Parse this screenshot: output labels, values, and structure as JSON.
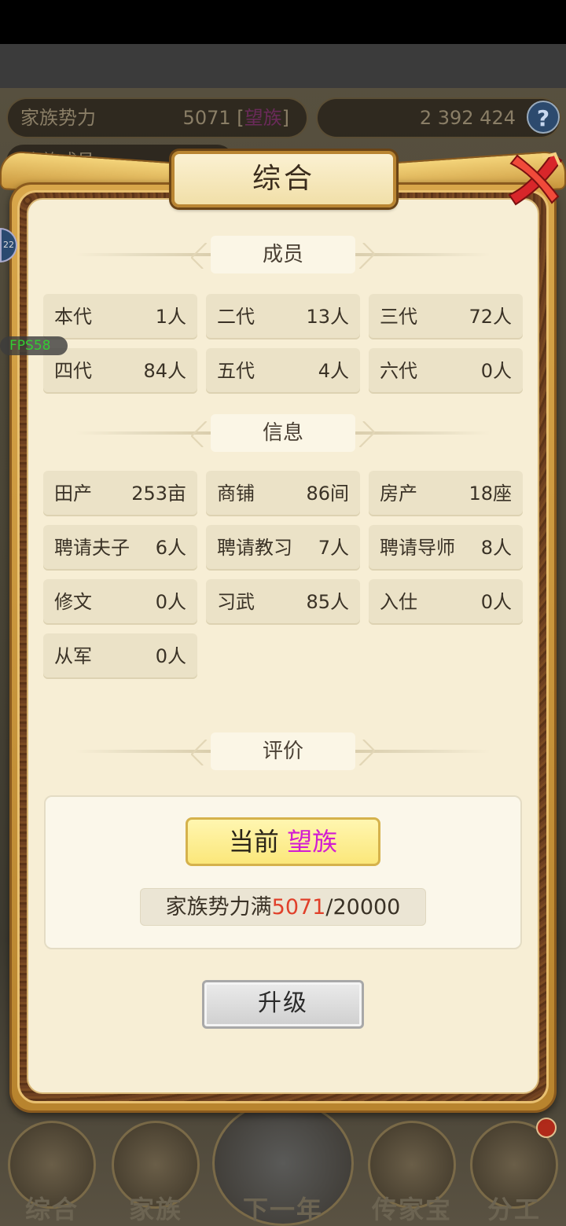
{
  "background": {
    "power_label": "家族势力",
    "power_value": "5071 [",
    "power_status": "望族",
    "power_close": "]",
    "currency": "2  392  424",
    "help": "?",
    "members_label": "家族成员",
    "fps": "FPS58",
    "side_badge": "22"
  },
  "dialog": {
    "title": "综合",
    "sections": {
      "members_title": "成员",
      "info_title": "信息",
      "eval_title": "评价"
    },
    "members": [
      {
        "k": "本代",
        "v": "1人"
      },
      {
        "k": "二代",
        "v": "13人"
      },
      {
        "k": "三代",
        "v": "72人"
      },
      {
        "k": "四代",
        "v": "84人"
      },
      {
        "k": "五代",
        "v": "4人"
      },
      {
        "k": "六代",
        "v": "0人"
      }
    ],
    "info": [
      {
        "k": "田产",
        "v": "253亩"
      },
      {
        "k": "商铺",
        "v": "86间"
      },
      {
        "k": "房产",
        "v": "18座"
      },
      {
        "k": "聘请夫子",
        "v": "6人"
      },
      {
        "k": "聘请教习",
        "v": "7人"
      },
      {
        "k": "聘请导师",
        "v": "8人"
      },
      {
        "k": "修文",
        "v": "0人"
      },
      {
        "k": "习武",
        "v": "85人"
      },
      {
        "k": "入仕",
        "v": "0人"
      },
      {
        "k": "从军",
        "v": "0人"
      }
    ],
    "evaluation": {
      "current_prefix": "当前",
      "current_rank": "望族",
      "power_prefix": "家族势力满",
      "power_current": "5071",
      "power_max": "/20000"
    },
    "upgrade_label": "升级"
  },
  "nav": {
    "items": [
      "综合",
      "家族",
      "下一年",
      "传家宝",
      "分工"
    ]
  },
  "colors": {
    "rank": "#d21cd2",
    "power_current": "#e0402a",
    "panel": "#f7eed5",
    "frame": "#d8a64a"
  }
}
